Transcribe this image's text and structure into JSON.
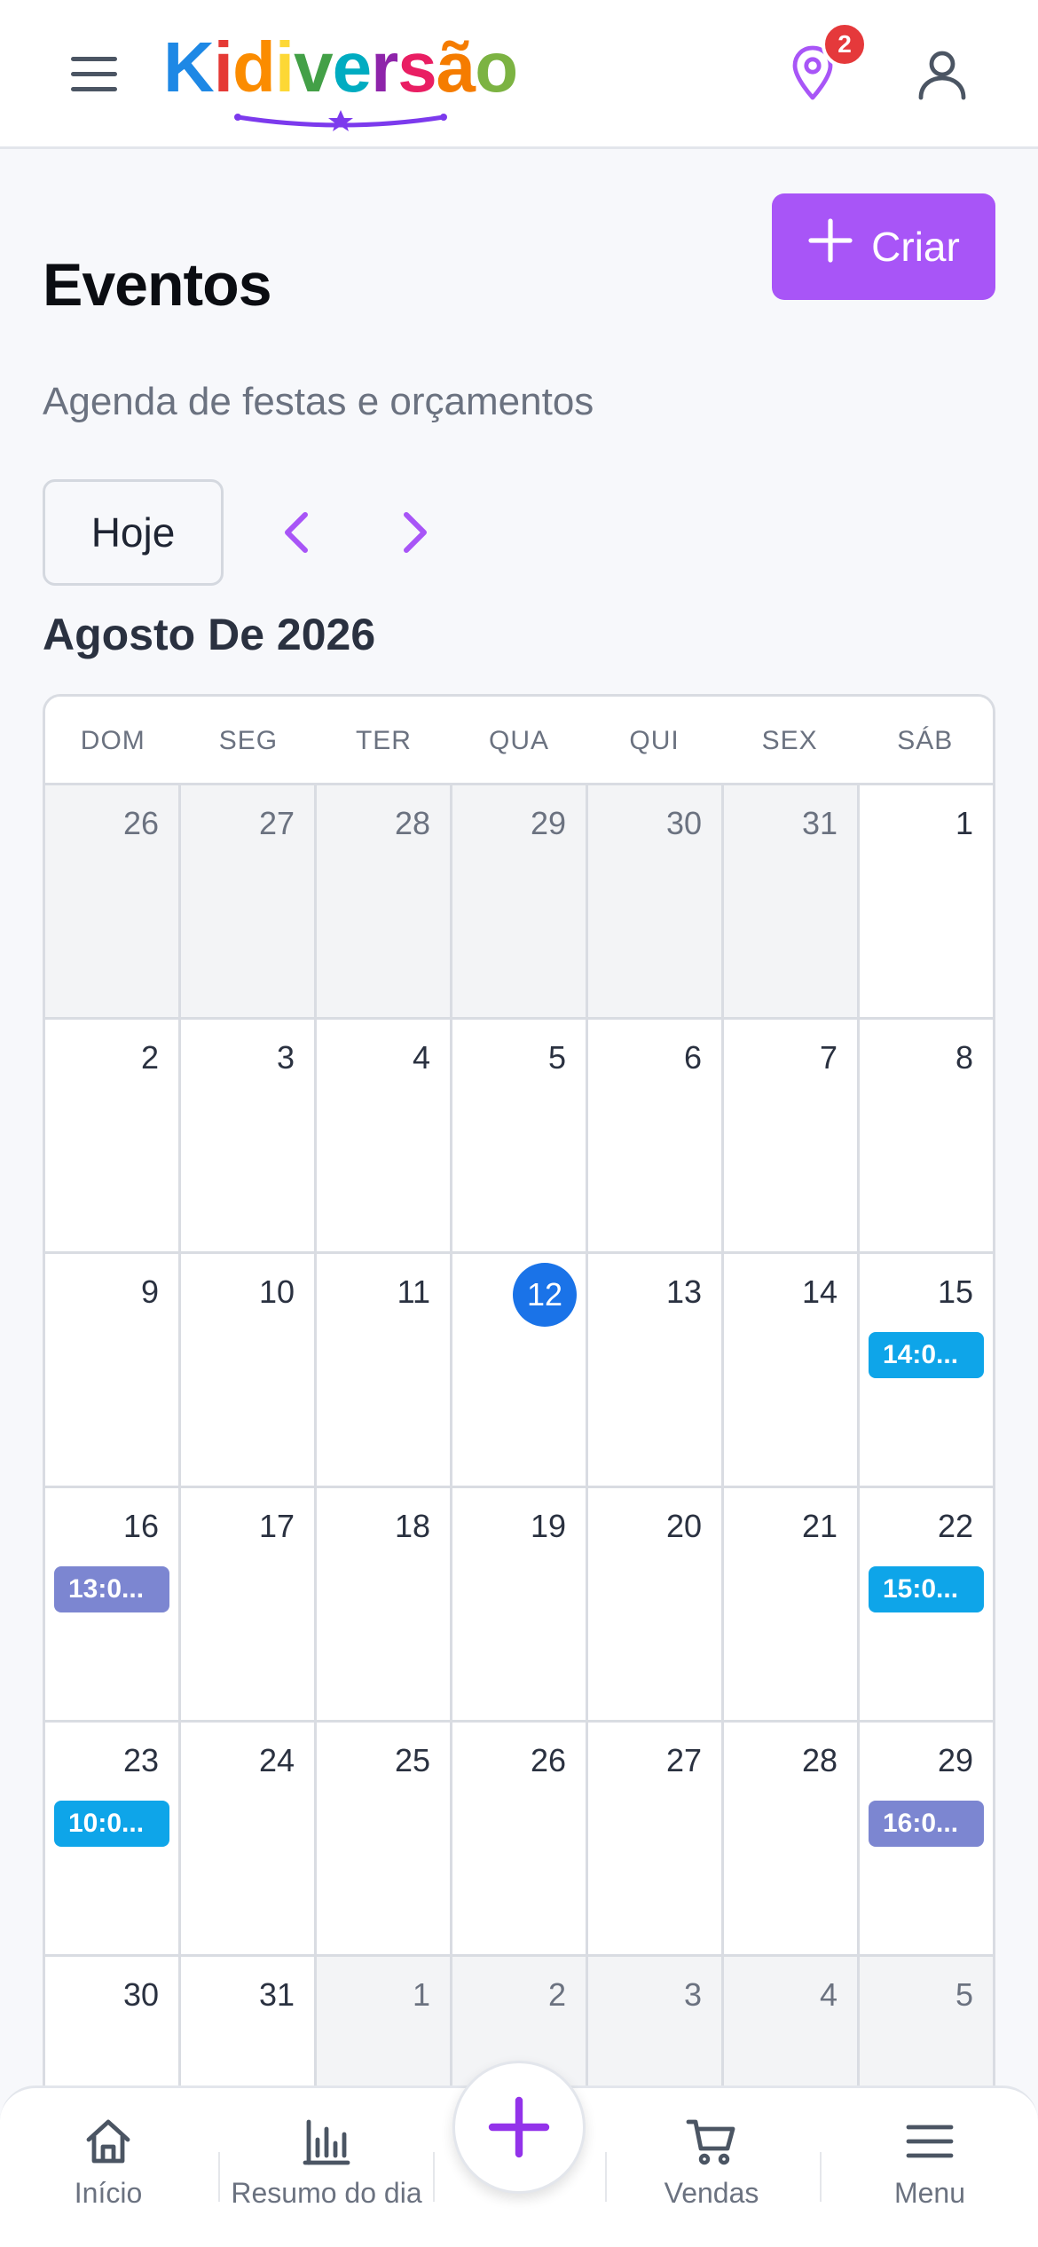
{
  "header": {
    "logo_text": "Kidiversão",
    "notification_count": "2",
    "brand_color": "#a855f7"
  },
  "page": {
    "title": "Eventos",
    "subtitle": "Agenda de festas e orçamentos",
    "create_label": "Criar"
  },
  "calendar_nav": {
    "today_label": "Hoje",
    "month_label": "Agosto De 2026"
  },
  "calendar": {
    "weekdays": [
      "DOM",
      "SEG",
      "TER",
      "QUA",
      "QUI",
      "SEX",
      "SÁB"
    ],
    "today": "12",
    "weeks": [
      [
        {
          "d": "26",
          "o": true
        },
        {
          "d": "27",
          "o": true
        },
        {
          "d": "28",
          "o": true
        },
        {
          "d": "29",
          "o": true
        },
        {
          "d": "30",
          "o": true
        },
        {
          "d": "31",
          "o": true
        },
        {
          "d": "1"
        }
      ],
      [
        {
          "d": "2"
        },
        {
          "d": "3"
        },
        {
          "d": "4"
        },
        {
          "d": "5"
        },
        {
          "d": "6"
        },
        {
          "d": "7"
        },
        {
          "d": "8"
        }
      ],
      [
        {
          "d": "9"
        },
        {
          "d": "10"
        },
        {
          "d": "11"
        },
        {
          "d": "12",
          "today": true
        },
        {
          "d": "13"
        },
        {
          "d": "14"
        },
        {
          "d": "15",
          "event": "14:0...",
          "color": "#0ea5e9"
        }
      ],
      [
        {
          "d": "16",
          "event": "13:0...",
          "color": "#7c86d1"
        },
        {
          "d": "17"
        },
        {
          "d": "18"
        },
        {
          "d": "19"
        },
        {
          "d": "20"
        },
        {
          "d": "21"
        },
        {
          "d": "22",
          "event": "15:0...",
          "color": "#0ea5e9"
        }
      ],
      [
        {
          "d": "23",
          "event": "10:0...",
          "color": "#0ea5e9"
        },
        {
          "d": "24"
        },
        {
          "d": "25"
        },
        {
          "d": "26"
        },
        {
          "d": "27"
        },
        {
          "d": "28"
        },
        {
          "d": "29",
          "event": "16:0...",
          "color": "#7c86d1"
        }
      ],
      [
        {
          "d": "30"
        },
        {
          "d": "31"
        },
        {
          "d": "1",
          "o": true
        },
        {
          "d": "2",
          "o": true
        },
        {
          "d": "3",
          "o": true
        },
        {
          "d": "4",
          "o": true
        },
        {
          "d": "5",
          "o": true
        }
      ]
    ]
  },
  "bottom_nav": {
    "items": [
      {
        "label": "Início",
        "icon": "home-icon"
      },
      {
        "label": "Resumo do dia",
        "icon": "bar-chart-icon"
      },
      {
        "label": "Vendas",
        "icon": "cart-icon"
      },
      {
        "label": "Menu",
        "icon": "menu-icon"
      }
    ],
    "fab_icon": "plus-icon"
  }
}
